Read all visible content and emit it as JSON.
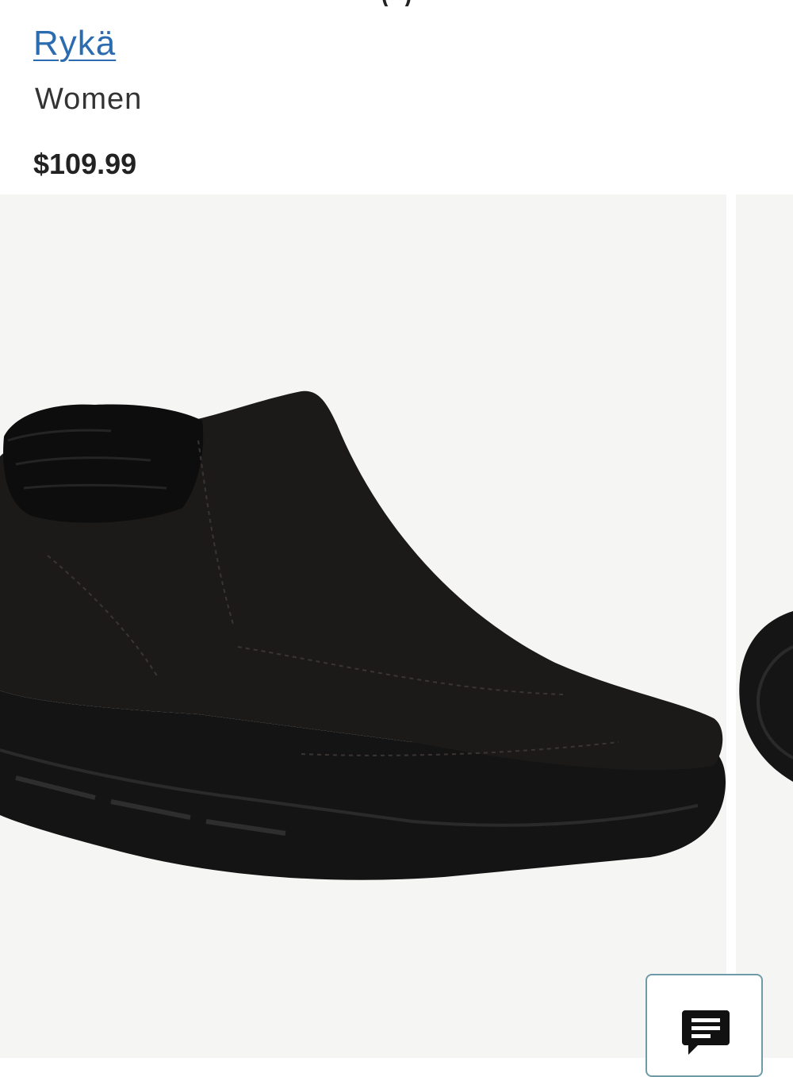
{
  "product": {
    "title_fragment": "( )",
    "brand": "Rykä",
    "gender": "Women",
    "price": "$109.99"
  },
  "gallery": {
    "main_image": "black-suede-ankle-boot-with-faux-fur-collar",
    "next_image": "boot-side-view-partial"
  },
  "chat": {
    "icon": "chat-bubble-icon"
  },
  "colors": {
    "brand_link": "#2b6cb0",
    "image_background": "#f5f5f4",
    "chat_border": "#6f9aa8"
  }
}
